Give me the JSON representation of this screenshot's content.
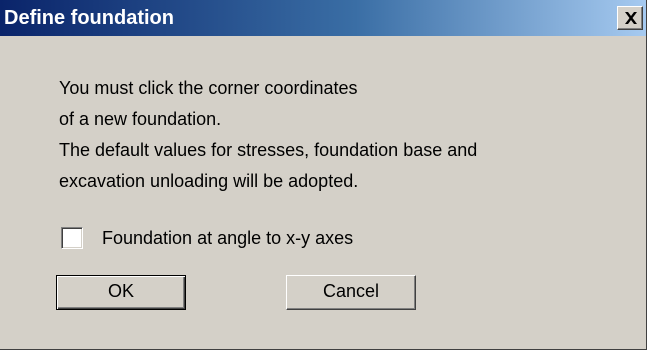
{
  "window": {
    "title": "Define foundation",
    "close_icon": "close-x-icon"
  },
  "message": {
    "lines": [
      "You must click the corner coordinates",
      "of a new foundation.",
      "The default values for stresses, foundation base and",
      "excavation unloading will be adopted."
    ]
  },
  "options": {
    "angle_checkbox_label": "Foundation at angle to x-y axes",
    "angle_checkbox_checked": false
  },
  "buttons": {
    "ok_label": "OK",
    "cancel_label": "Cancel"
  },
  "colors": {
    "title_bar_start": "#0a246a",
    "title_bar_end": "#a6caf0",
    "dialog_background": "#d4d0c8"
  }
}
